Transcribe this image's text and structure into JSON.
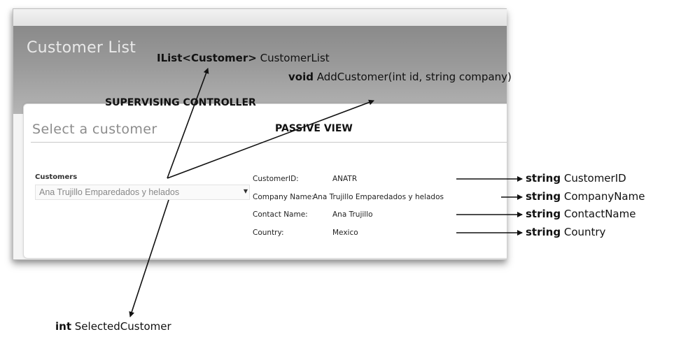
{
  "window": {
    "header_title": "Customer List",
    "panel_heading": "Select a customer"
  },
  "selector": {
    "label": "Customers",
    "selected_value": "Ana Trujillo Emparedados y helados",
    "arrow_glyph": "▼"
  },
  "details": [
    {
      "label": "CustomerID:",
      "value": "ANATR"
    },
    {
      "label": "Company Name:",
      "value": "Ana Trujillo Emparedados y helados"
    },
    {
      "label": "Contact Name:",
      "value": "Ana Trujillo"
    },
    {
      "label": "Country:",
      "value": "Mexico"
    }
  ],
  "annotations": {
    "ilist_type": "IList<Customer>",
    "ilist_name": "CustomerList",
    "add_keyword": "void",
    "add_signature": "AddCustomer(int id, string company)",
    "supervising_controller": "SUPERVISING CONTROLLER",
    "passive_view": "PASSIVE VIEW",
    "selected_keyword": "int",
    "selected_name": "SelectedCustomer",
    "props": [
      {
        "type": "string",
        "name": "CustomerID"
      },
      {
        "type": "string",
        "name": "CompanyName"
      },
      {
        "type": "string",
        "name": "ContactName"
      },
      {
        "type": "string",
        "name": "Country"
      }
    ]
  }
}
